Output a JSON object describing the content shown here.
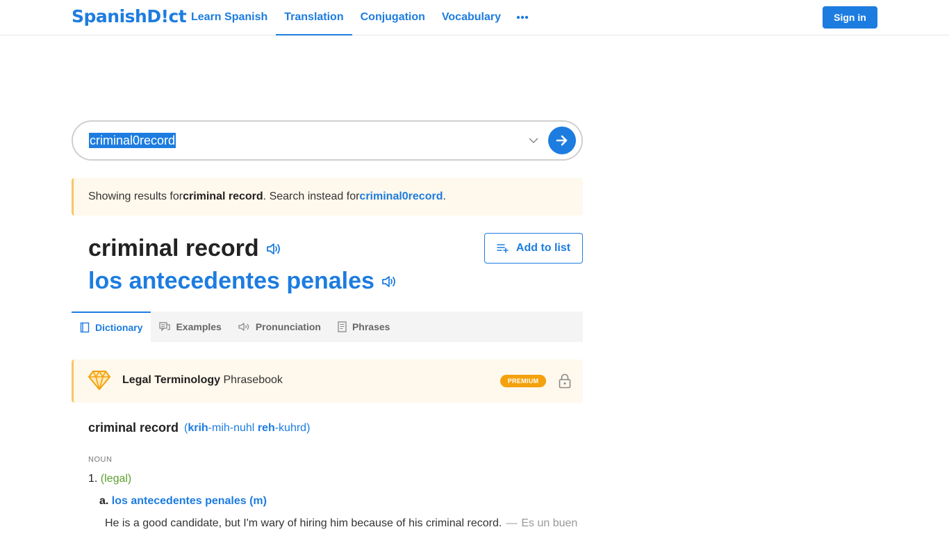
{
  "header": {
    "logo_text": "SpanishD!ct",
    "nav": [
      {
        "label": "Learn Spanish"
      },
      {
        "label": "Translation"
      },
      {
        "label": "Conjugation"
      },
      {
        "label": "Vocabulary"
      }
    ],
    "more_icon": "more-dots-icon",
    "signin_label": "Sign in"
  },
  "search": {
    "value": "criminal0record",
    "chevron_icon": "chevron-down-icon",
    "go_icon": "arrow-right-icon"
  },
  "notice": {
    "prefix": "Showing results for ",
    "result": "criminal record",
    "middle": ". Search instead for ",
    "original": "criminal0record",
    "suffix": "."
  },
  "headword": {
    "word": "criminal record",
    "translation": "los antecedentes penales",
    "speaker_icon": "speaker-icon"
  },
  "add_to_list": {
    "label": "Add to list",
    "icon": "playlist-add-icon"
  },
  "tabs": [
    {
      "label": "Dictionary",
      "icon": "book-icon"
    },
    {
      "label": "Examples",
      "icon": "chat-icon"
    },
    {
      "label": "Pronunciation",
      "icon": "speaker-icon"
    },
    {
      "label": "Phrases",
      "icon": "document-icon"
    }
  ],
  "phrasebook": {
    "title": "Legal Terminology",
    "subtitle": " Phrasebook",
    "badge": "PREMIUM",
    "icon": "diamond-icon",
    "lock_icon": "lock-icon"
  },
  "entry": {
    "word": "criminal record",
    "pron_open": "(",
    "pron_s1": "krih",
    "pron_s2": "-mih-nuhl ",
    "pron_s3": "reh",
    "pron_s4": "-kuhrd",
    "pron_close": ")",
    "pos": "NOUN",
    "sense_num": "1.",
    "sense_context": "(legal)",
    "sub_letter": "a.",
    "sub_translation": "los antecedentes penales (m)",
    "example_en": "He is a good candidate, but I'm wary of hiring him because of his criminal record.",
    "example_dash": "—",
    "example_es": "Es un buen"
  },
  "colors": {
    "brand": "#1d7ce0",
    "notice_bg": "#fff8ec",
    "notice_border": "#f6c766",
    "premium": "#f3a10c",
    "context_green": "#5aa02c"
  }
}
